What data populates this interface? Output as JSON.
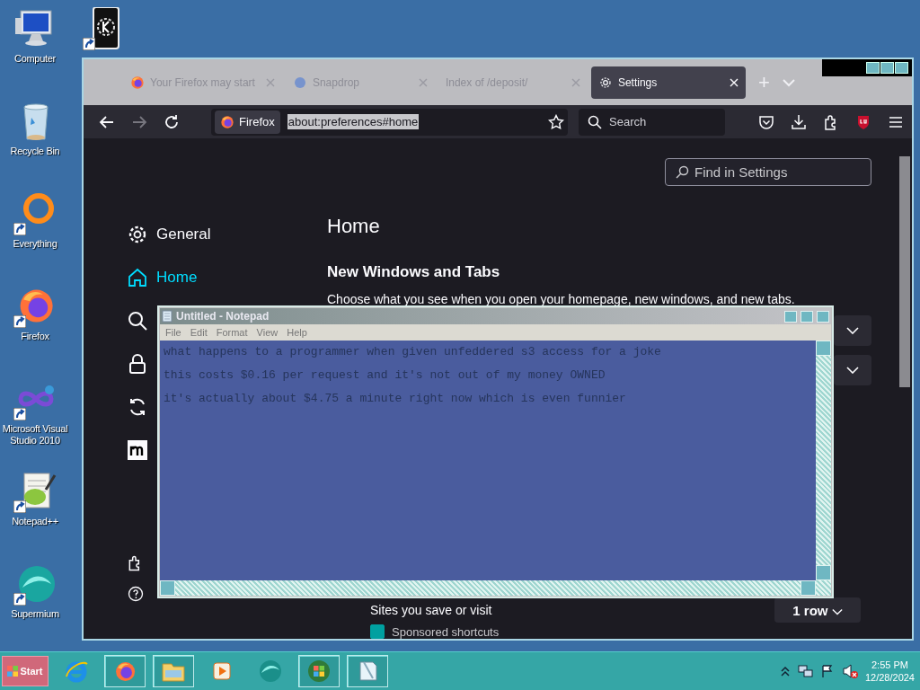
{
  "desktop_icons": [
    {
      "label": "Computer",
      "kind": "computer",
      "shortcut": false
    },
    {
      "label": "Recycle Bin",
      "kind": "recycle",
      "shortcut": false
    },
    {
      "label": "Everything",
      "kind": "everything",
      "shortcut": true
    },
    {
      "label": "Firefox",
      "kind": "firefox",
      "shortcut": true
    },
    {
      "label": "Microsoft Visual Studio 2010",
      "kind": "vs",
      "shortcut": true
    },
    {
      "label": "Notepad++",
      "kind": "notepadpp",
      "shortcut": true
    },
    {
      "label": "Supermium",
      "kind": "supermium",
      "shortcut": true
    }
  ],
  "desktop_icon_2": {
    "kind": "phone",
    "shortcut": true
  },
  "firefox": {
    "tabs": [
      {
        "label": "Your Firefox may start",
        "kind": "firefox",
        "selected": false
      },
      {
        "label": "Snapdrop",
        "kind": "snapdrop",
        "selected": false
      },
      {
        "label": "Index of /deposit/",
        "kind": "plain",
        "selected": false
      },
      {
        "label": "Settings",
        "kind": "settings",
        "selected": true
      }
    ],
    "new_tab": "+",
    "identity": "Firefox",
    "url": "about:preferences#home",
    "search": {
      "placeholder": "Search"
    },
    "find": {
      "placeholder": "Find in Settings"
    },
    "sidebar": [
      {
        "label": "General",
        "kind": "general",
        "selected": false
      },
      {
        "label": "Home",
        "kind": "home",
        "selected": true
      },
      {
        "kind": "search",
        "selected": false
      },
      {
        "kind": "privacy",
        "selected": false
      },
      {
        "kind": "sync",
        "selected": false
      },
      {
        "kind": "more",
        "selected": false
      }
    ],
    "sidebar_footer": [
      {
        "kind": "extensions"
      },
      {
        "kind": "help"
      }
    ],
    "heading": "Home",
    "section": "New Windows and Tabs",
    "description": "Choose what you see when you open your homepage, new windows, and new tabs.",
    "shortcuts": {
      "label": "Sites you save or visit",
      "rows": "1 row"
    },
    "sponsored": {
      "label": "Sponsored shortcuts",
      "checked": true
    }
  },
  "notepad": {
    "title": "Untitled - Notepad",
    "menu": [
      "File",
      "Edit",
      "Format",
      "View",
      "Help"
    ],
    "lines": [
      "what happens to a programmer when given unfeddered s3 access for a joke",
      "this costs $0.16 per request and it's not out of my money OWNED",
      "it's actually about $4.75 a minute right now which is even funnier"
    ]
  },
  "taskbar": {
    "start": "Start",
    "apps": [
      {
        "kind": "ie",
        "open": false
      },
      {
        "kind": "firefox",
        "open": true
      },
      {
        "kind": "explorer",
        "open": true
      },
      {
        "kind": "media",
        "open": false
      },
      {
        "kind": "supermium",
        "open": false
      },
      {
        "kind": "windows",
        "open": true
      },
      {
        "kind": "notepad",
        "open": true
      }
    ],
    "time": "2:55 PM",
    "date": "12/28/2024"
  }
}
